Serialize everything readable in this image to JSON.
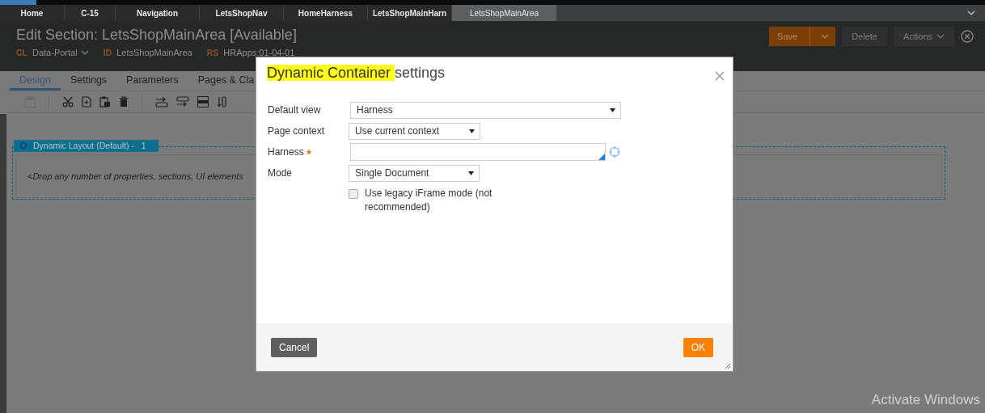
{
  "top_tabs": [
    {
      "label": "Home",
      "selected": false
    },
    {
      "label": "C-15",
      "selected": false
    },
    {
      "label": "Navigation",
      "selected": false
    },
    {
      "label": "LetsShopNav",
      "selected": false
    },
    {
      "label": "HomeHarness",
      "selected": false
    },
    {
      "label": "LetsShopMainHarn",
      "selected": false
    },
    {
      "label": "LetsShopMainArea",
      "selected": true
    }
  ],
  "header": {
    "title": "Edit Section: LetsShopMainArea [Available]",
    "meta": [
      {
        "key": "CL",
        "value": "Data-Portal",
        "dropdown": true
      },
      {
        "key": "ID",
        "value": "LetsShopMainArea",
        "dropdown": false
      },
      {
        "key": "RS",
        "value": "HRApps:01-04-01",
        "dropdown": false
      }
    ],
    "buttons": [
      {
        "label": "Save",
        "kind": "split"
      },
      {
        "label": "Delete",
        "kind": "plain"
      },
      {
        "label": "Actions",
        "kind": "menu"
      }
    ]
  },
  "rule_tabs": [
    {
      "label": "Design",
      "selected": true
    },
    {
      "label": "Settings",
      "selected": false
    },
    {
      "label": "Parameters",
      "selected": false
    },
    {
      "label": "Pages & Cla",
      "selected": false
    }
  ],
  "canvas": {
    "layout_label": "Dynamic Layout (Default) -",
    "layout_count": "1",
    "drop_hint": "<Drop any number of properties, sections, UI elements"
  },
  "dialog": {
    "title_highlighted": "Dynamic Container",
    "title_rest": "settings",
    "fields": [
      {
        "label": "Default view",
        "kind": "select",
        "value": "Harness",
        "required": false
      },
      {
        "label": "Page context",
        "kind": "select",
        "value": "Use current context",
        "required": false
      },
      {
        "label": "Harness",
        "kind": "autocomplete",
        "required": true
      },
      {
        "label": "Mode",
        "kind": "select",
        "value": "Single Document",
        "required": false
      }
    ],
    "checkbox": {
      "label": "Use legacy iFrame mode (not recommended)",
      "checked": false
    },
    "buttons": [
      {
        "label": "Cancel",
        "kind": "secondary"
      },
      {
        "label": "OK",
        "kind": "primary"
      }
    ]
  },
  "os_notice": "Activate Windows"
}
